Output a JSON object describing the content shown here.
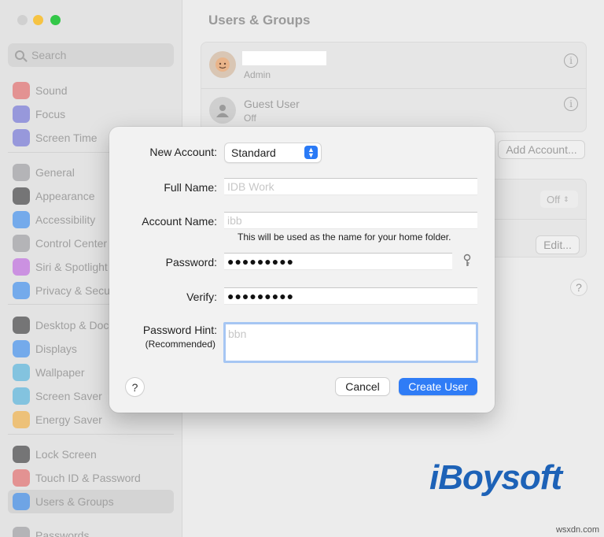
{
  "window": {
    "traffic_lights": {
      "close": "#ff5f57",
      "minimize": "#febc2e",
      "zoom": "#28c840"
    }
  },
  "sidebar": {
    "search_placeholder": "Search",
    "items": [
      {
        "label": "Sound",
        "icon": "sound-icon",
        "color": "#e35050"
      },
      {
        "label": "Focus",
        "icon": "focus-icon",
        "color": "#5a5bd6"
      },
      {
        "label": "Screen Time",
        "icon": "screen-time-icon",
        "color": "#5a5bd6"
      },
      {
        "label": "General",
        "icon": "general-icon",
        "color": "#8e8e93"
      },
      {
        "label": "Appearance",
        "icon": "appearance-icon",
        "color": "#1c1c1e"
      },
      {
        "label": "Accessibility",
        "icon": "accessibility-icon",
        "color": "#1a7cf2"
      },
      {
        "label": "Control Center",
        "icon": "control-center-icon",
        "color": "#8e8e93"
      },
      {
        "label": "Siri & Spotlight",
        "icon": "siri-icon",
        "color": "#b84fe0"
      },
      {
        "label": "Privacy & Security",
        "icon": "privacy-icon",
        "color": "#1a7cf2"
      },
      {
        "label": "Desktop & Dock",
        "icon": "desktop-dock-icon",
        "color": "#1c1c1e"
      },
      {
        "label": "Displays",
        "icon": "displays-icon",
        "color": "#1a7cf2"
      },
      {
        "label": "Wallpaper",
        "icon": "wallpaper-icon",
        "color": "#34aadc"
      },
      {
        "label": "Screen Saver",
        "icon": "screen-saver-icon",
        "color": "#34aadc"
      },
      {
        "label": "Energy Saver",
        "icon": "energy-saver-icon",
        "color": "#f5a623"
      },
      {
        "label": "Lock Screen",
        "icon": "lock-screen-icon",
        "color": "#1c1c1e"
      },
      {
        "label": "Touch ID & Password",
        "icon": "touch-id-icon",
        "color": "#e35050"
      },
      {
        "label": "Users & Groups",
        "icon": "users-groups-icon",
        "color": "#1a7cf2",
        "selected": true
      },
      {
        "label": "Passwords",
        "icon": "passwords-icon",
        "color": "#8e8e93"
      }
    ]
  },
  "main": {
    "title": "Users & Groups",
    "users": [
      {
        "name": "",
        "role": "Admin"
      },
      {
        "name": "Guest User",
        "role": "Off"
      }
    ],
    "add_account_label": "Add Account...",
    "auto_login_value": "Off",
    "edit_label": "Edit...",
    "help_label": "?"
  },
  "dialog": {
    "new_account_label": "New Account:",
    "new_account_value": "Standard",
    "full_name_label": "Full Name:",
    "full_name_placeholder": "IDB Work",
    "account_name_label": "Account Name:",
    "account_name_placeholder": "ibb",
    "account_name_note": "This will be used as the name for your home folder.",
    "password_label": "Password:",
    "password_value": "●●●●●●●●●",
    "verify_label": "Verify:",
    "verify_value": "●●●●●●●●●",
    "hint_label": "Password Hint:",
    "hint_sublabel": "(Recommended)",
    "hint_placeholder": "bbn",
    "help_label": "?",
    "cancel_label": "Cancel",
    "create_label": "Create User",
    "accent_color": "#2f7cf6"
  },
  "branding": {
    "logo_text": "iBoysoft",
    "watermark": "wsxdn.com"
  }
}
